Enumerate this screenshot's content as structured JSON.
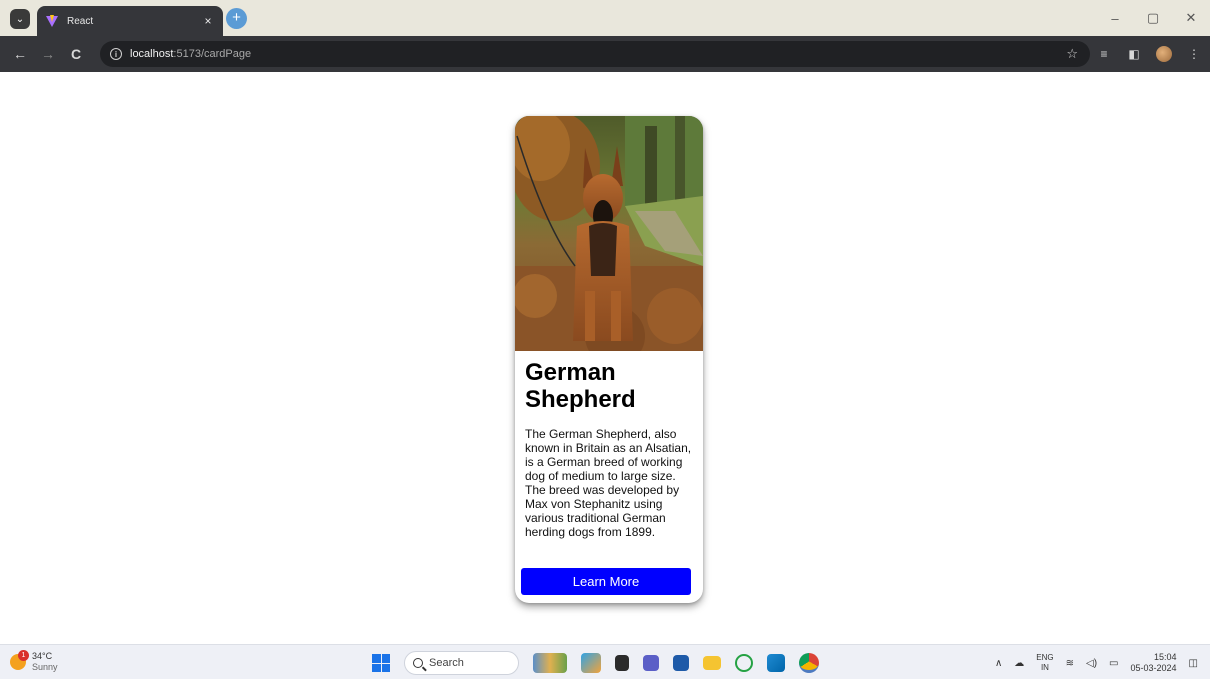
{
  "browser": {
    "tab": {
      "title": "React",
      "close": "×"
    },
    "new_tab": "+",
    "window": {
      "minimize": "–",
      "restore": "▢",
      "close": "✕"
    },
    "nav": {
      "back": "←",
      "forward": "→",
      "reload": "C"
    },
    "address": {
      "host": "localhost",
      "path": ":5173/cardPage"
    }
  },
  "card": {
    "title": "German Shepherd",
    "description": "The German Shepherd, also known in Britain as an Alsatian, is a German breed of working dog of medium to large size. The breed was developed by Max von Stephanitz using various traditional German herding dogs from 1899.",
    "button_label": "Learn More",
    "button_color": "#0000ff"
  },
  "taskbar": {
    "weather": {
      "temp": "34°C",
      "condition": "Sunny",
      "badge": "1"
    },
    "search_label": "Search",
    "tray": {
      "lang_line1": "ENG",
      "lang_line2": "IN",
      "time": "15:04",
      "date": "05-03-2024"
    }
  }
}
